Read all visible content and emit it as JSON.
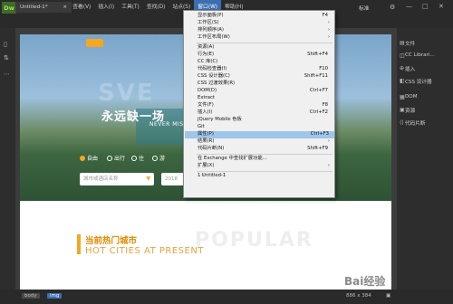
{
  "menubar": {
    "logo": "Dw",
    "items": [
      "文件(F)",
      "编辑(E)",
      "查看(V)",
      "插入(I)",
      "工具(T)",
      "查找(D)",
      "站点(S)",
      "窗口(W)",
      "帮助(H)"
    ],
    "active_index": 7,
    "standard": "标准",
    "gear": "⚙",
    "min": "—",
    "max": "□",
    "close": "✕"
  },
  "tab": {
    "label": "Untitled-1*",
    "close": "×"
  },
  "window_menu": [
    {
      "label": "显示面板(P)",
      "shortcut": "F4"
    },
    {
      "label": "工作区(S)",
      "arrow": "›"
    },
    {
      "label": "排列顺序(A)",
      "arrow": "›"
    },
    {
      "label": "工作区布局(W)",
      "arrow": "›"
    },
    {
      "sep": true
    },
    {
      "label": "资源(A)"
    },
    {
      "label": "行为(E)",
      "shortcut": "Shift+F4"
    },
    {
      "label": "CC 库(C)"
    },
    {
      "label": "代码检查器(I)",
      "shortcut": "F10"
    },
    {
      "label": "CSS 设计器(C)",
      "shortcut": "Shift+F11"
    },
    {
      "label": "CSS 过渡效果(R)"
    },
    {
      "label": "DOM(D)",
      "shortcut": "Ctrl+F7"
    },
    {
      "label": "Extract"
    },
    {
      "label": "文件(F)",
      "shortcut": "F8"
    },
    {
      "label": "插入(I)",
      "shortcut": "Ctrl+F2"
    },
    {
      "label": "jQuery Mobile 色板"
    },
    {
      "label": "Git"
    },
    {
      "label": "属性(P)",
      "shortcut": "Ctrl+F3",
      "highlight": true
    },
    {
      "label": "结果(R)",
      "arrow": "›"
    },
    {
      "label": "代码片断(N)",
      "shortcut": "Shift+F9"
    },
    {
      "sep": true
    },
    {
      "label": "在 Exchange 中查找扩展功能..."
    },
    {
      "label": "扩展(X)",
      "arrow": "›"
    },
    {
      "sep": true
    },
    {
      "label": "1 Untitled-1",
      "checked": true
    }
  ],
  "right_panel": [
    {
      "icon": "▤",
      "label": "文件"
    },
    {
      "icon": "◫",
      "label": "CC Librari..."
    },
    {
      "icon": "⊕",
      "label": "插入"
    },
    {
      "icon": "◧",
      "label": "CSS 设计器"
    },
    {
      "icon": "▦",
      "label": "DOM"
    },
    {
      "icon": "▣",
      "label": "资源"
    },
    {
      "icon": "⟨⟩",
      "label": "代码片断"
    }
  ],
  "hero": {
    "bg_word": "SVE",
    "title": "永远缺一场",
    "subtitle": "NEVER MIS",
    "radios": [
      "自由",
      "出行",
      "住",
      "游"
    ],
    "input1": "城市或酒店名称",
    "input2": "2018"
  },
  "section": {
    "title": "当前热门城市",
    "subtitle": "HOT CITIES AT PRESENT",
    "bg_word": "POPULAR"
  },
  "status": {
    "body": "body",
    "img": "img",
    "size": "886 x 384"
  },
  "watermark": "Bai经验"
}
